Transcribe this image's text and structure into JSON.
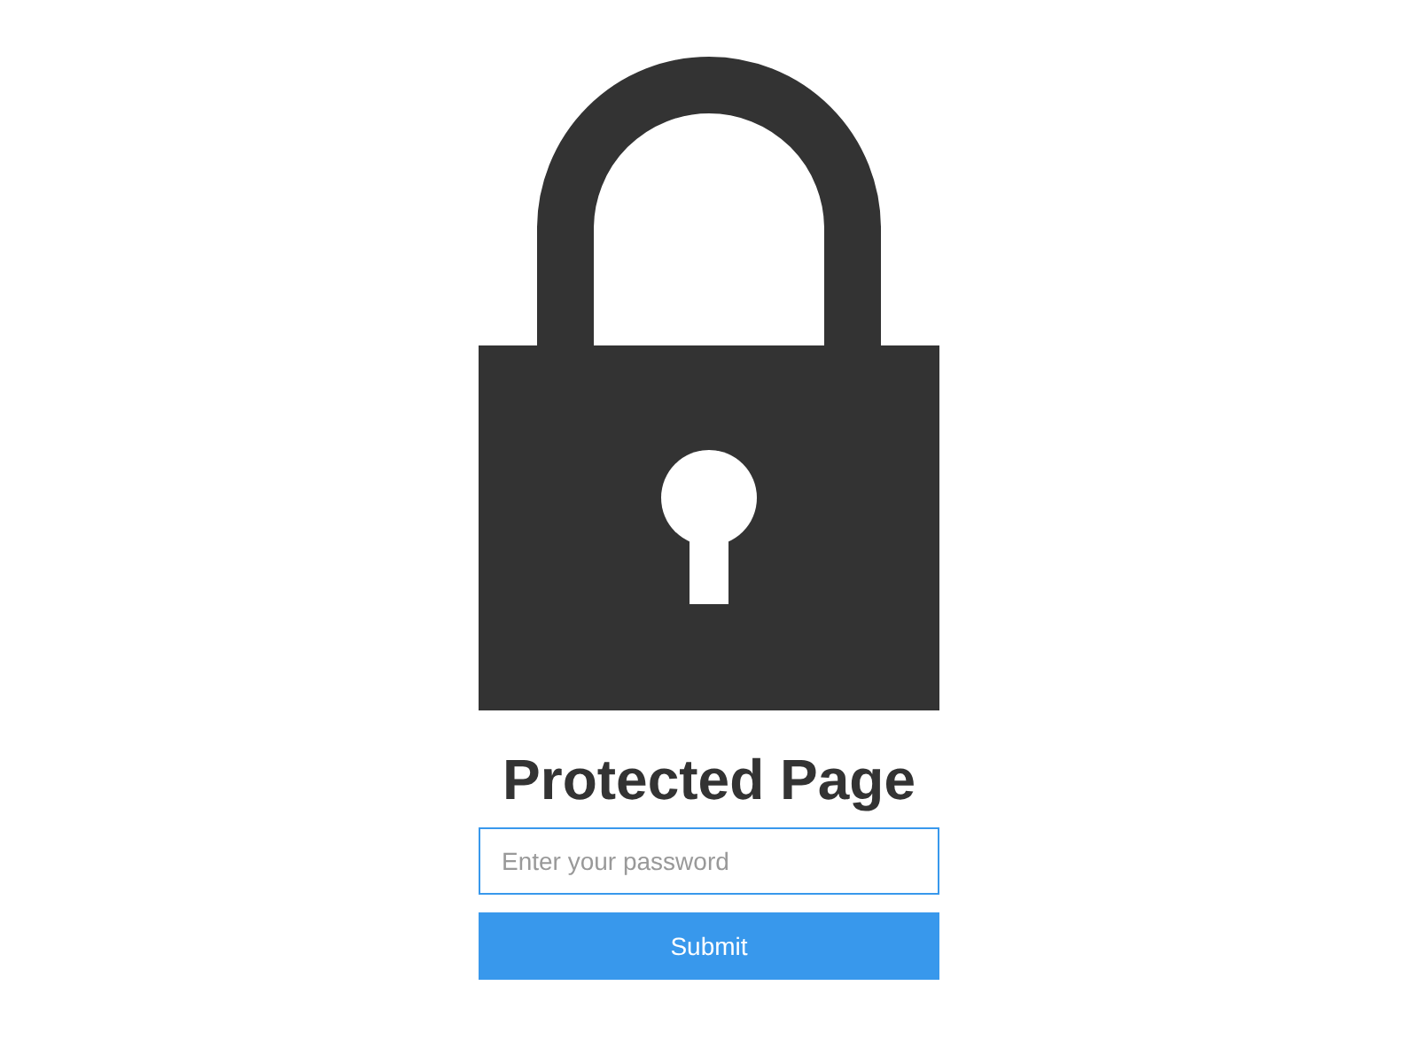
{
  "title": "Protected Page",
  "password_field": {
    "placeholder": "Enter your password",
    "focused": true
  },
  "submit_button": {
    "label": "Submit"
  }
}
